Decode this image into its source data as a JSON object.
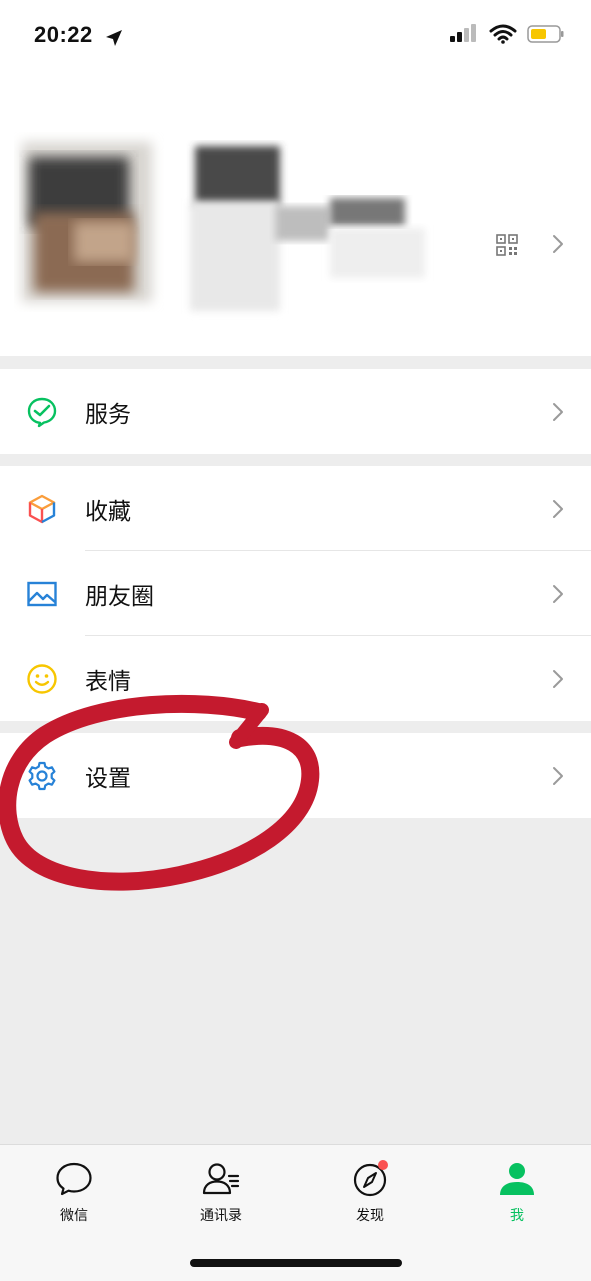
{
  "status_bar": {
    "time": "20:22"
  },
  "menu": {
    "services": {
      "label": "服务"
    },
    "favorites": {
      "label": "收藏"
    },
    "moments": {
      "label": "朋友圈"
    },
    "stickers": {
      "label": "表情"
    },
    "settings": {
      "label": "设置"
    }
  },
  "tabbar": {
    "tabs": [
      {
        "label": "微信"
      },
      {
        "label": "通讯录"
      },
      {
        "label": "发现"
      },
      {
        "label": "我"
      }
    ],
    "active_color": "#07c160"
  },
  "colors": {
    "annotation": "#c41a2e",
    "badge": "#fa5151"
  }
}
